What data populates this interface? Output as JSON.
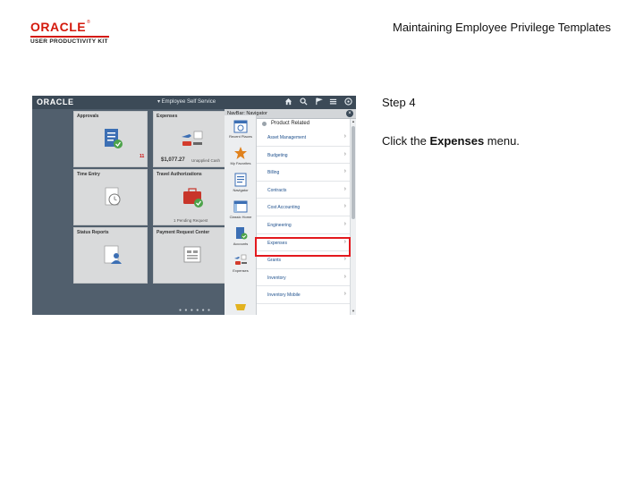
{
  "logo": {
    "word": "ORACLE",
    "tm": "®",
    "sub": "USER PRODUCTIVITY KIT"
  },
  "doc_title": "Maintaining Employee Privilege Templates",
  "screenshot": {
    "brand": "ORACLE",
    "header_title": "▾ Employee Self Service",
    "tiles": [
      {
        "title": "Approvals"
      },
      {
        "title": "Expenses",
        "amount": "$1,077.27",
        "caption": "Unapplied Cash",
        "badge": "11"
      },
      {
        "title": "Time Entry"
      },
      {
        "title": "Travel Authorizations",
        "caption": "1 Pending Request"
      },
      {
        "title": "Status Reports"
      },
      {
        "title": "Payment Request Center"
      }
    ],
    "pager_dots": "● ● ● ● ● ●",
    "nav_header": "NavBar: Navigator",
    "icon_buttons": [
      "Recent Places",
      "My Favorites",
      "Navigator",
      "Classic Home",
      "Accounts",
      "Expenses"
    ],
    "nav_title": "Product Related",
    "nav_items": [
      "Asset Management",
      "Budgeting",
      "Billing",
      "Contracts",
      "Cost Accounting",
      "Engineering",
      "Expenses",
      "Grants",
      "Inventory",
      "Inventory Mobile"
    ],
    "chevron": "›"
  },
  "step_label": "Step 4",
  "instruction": {
    "before": "Click the ",
    "bold": "Expenses",
    "after": " menu."
  }
}
